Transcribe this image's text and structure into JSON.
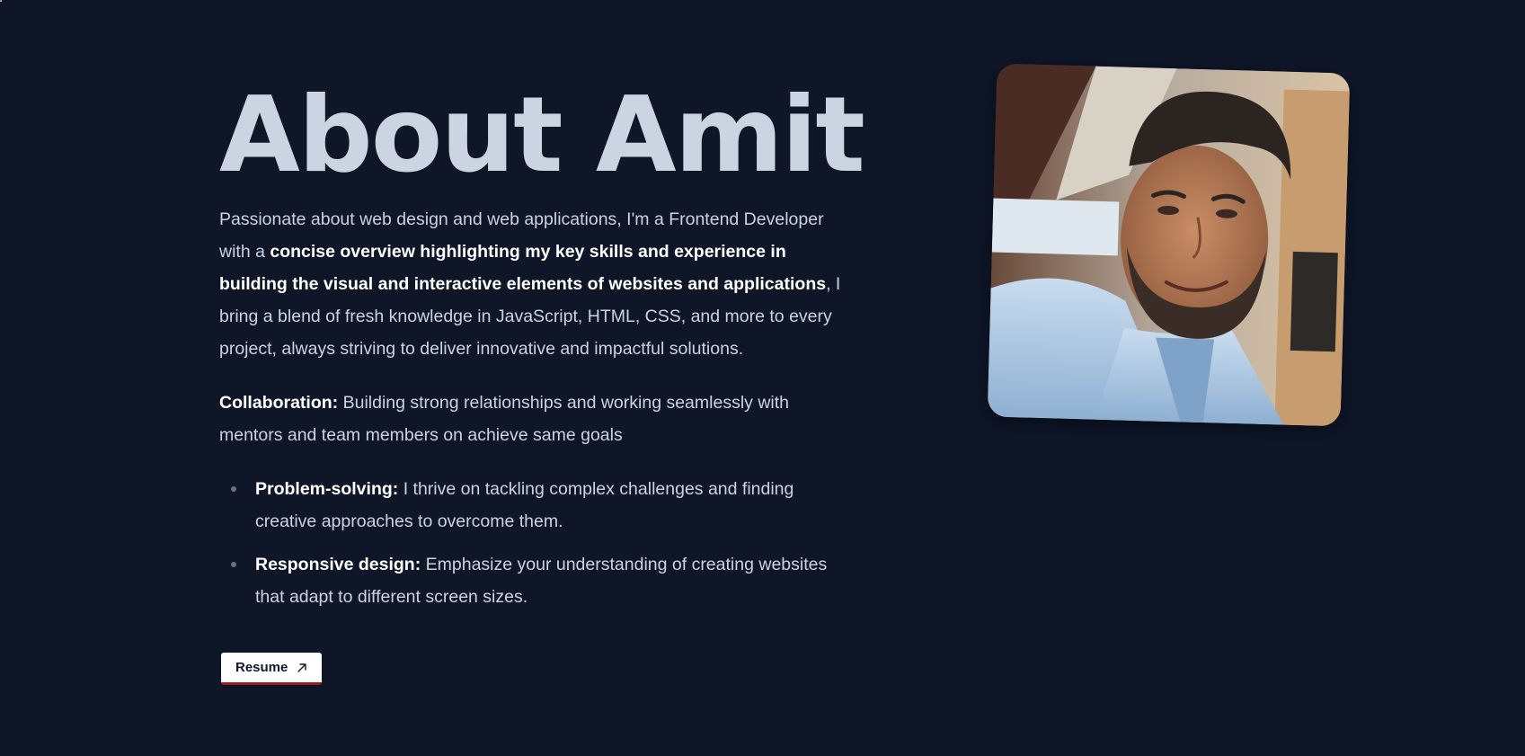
{
  "about": {
    "title": "About Amit",
    "intro": {
      "part1": "Passionate about web design and web applications, I'm a Frontend Developer with a ",
      "highlight": "concise overview highlighting my key skills and experience in building the visual and interactive elements of websites and applications",
      "part2": ", I bring a blend of fresh knowledge in JavaScript, HTML, CSS, and more to every project, always striving to deliver innovative and impactful solutions."
    },
    "collaboration": {
      "label": "Collaboration:",
      "text": " Building strong relationships and working seamlessly with mentors and team members on achieve same goals"
    },
    "points": [
      {
        "label": "Problem-solving:",
        "text": " I thrive on tackling complex challenges and finding creative approaches to overcome them."
      },
      {
        "label": "Responsive design:",
        "text": " Emphasize your understanding of creating websites that adapt to different screen sizes."
      }
    ],
    "resume_label": "Resume",
    "resume_icon": "arrow-up-right-icon",
    "photo_icon": "profile-photo"
  },
  "colors": {
    "background": "#0e1628",
    "text": "#cbd5e1",
    "emphasis": "#ffffff",
    "button_bg": "#ffffff",
    "button_accent": "#9b1c24"
  }
}
